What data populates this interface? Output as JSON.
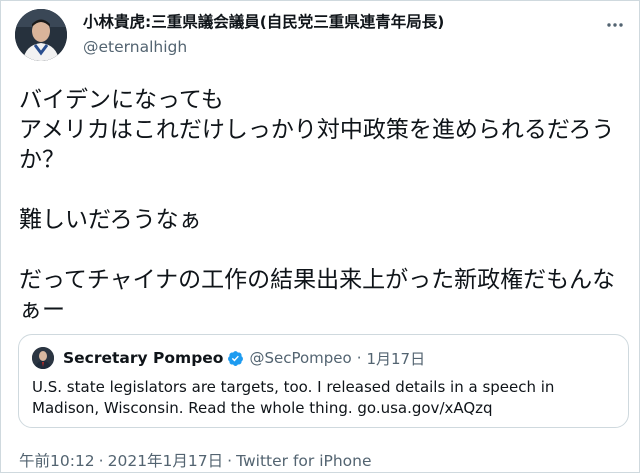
{
  "author": {
    "display_name": "小林貴虎:三重県議会議員(自民党三重県連青年局長)",
    "handle": "@eternalhigh"
  },
  "tweet": {
    "text": "バイデンになっても\nアメリカはこれだけしっかり対中政策を進められるだろうか？\n\n難しいだろうなぁ\n\nだってチャイナの工作の結果出来上がった新政権だもんなぁー"
  },
  "quoted_tweet": {
    "display_name": "Secretary Pompeo",
    "handle": "@SecPompeo",
    "separator": "·",
    "date": "1月17日",
    "text": "U.S. state legislators are targets, too. I released details in a speech in Madison, Wisconsin. Read the whole thing. go.usa.gov/xAQzq"
  },
  "meta": {
    "time": "午前10:12",
    "separator": "·",
    "date": "2021年1月17日",
    "client": "Twitter for iPhone"
  },
  "icons": {
    "more": "more-dots-icon",
    "verified": "verified-badge-icon"
  },
  "colors": {
    "text": "#0f1419",
    "secondary": "#536471",
    "border": "#cfd9de",
    "verified": "#1d9bf0"
  }
}
